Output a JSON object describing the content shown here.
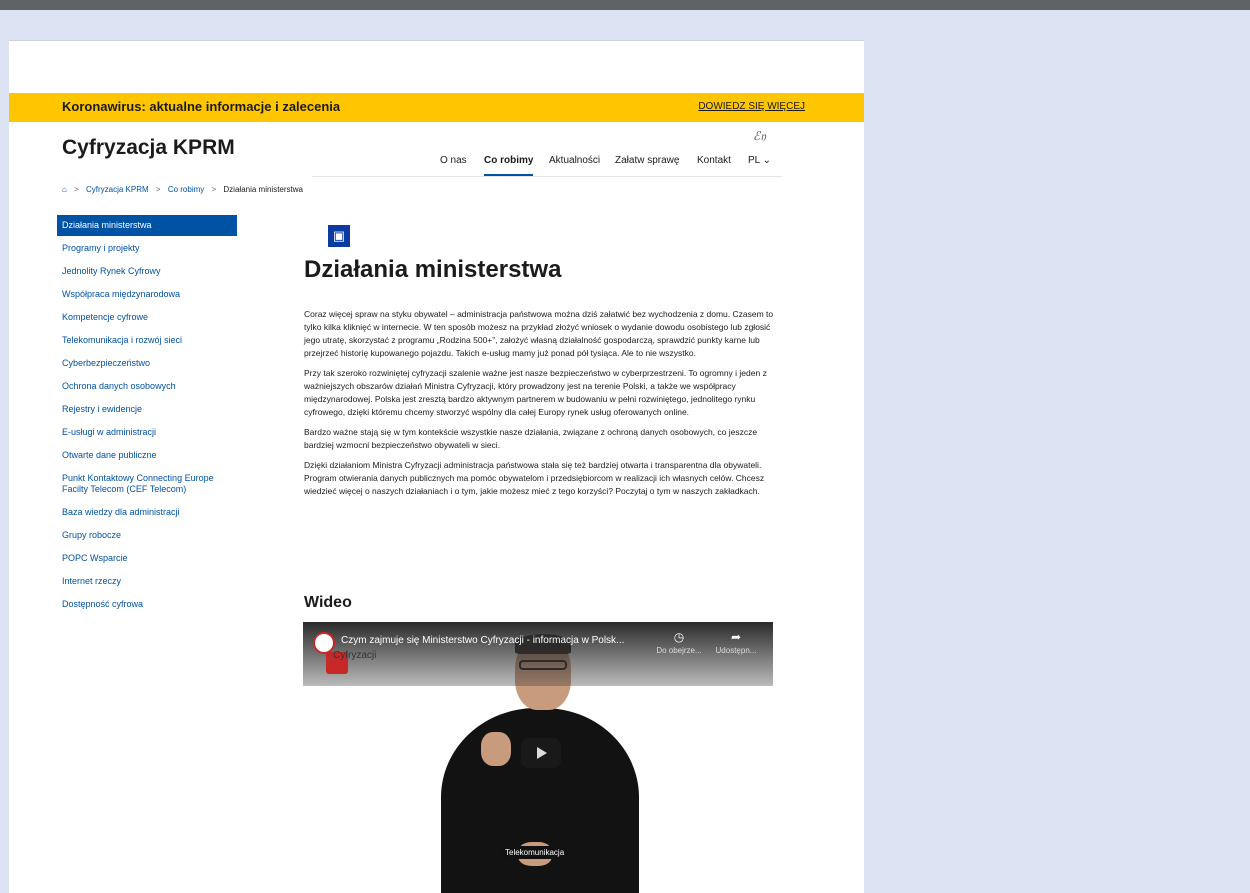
{
  "covid": {
    "title": "Koronawirus: aktualne informacje i zalecenia",
    "link": "DOWIEDZ SIĘ WIĘCEJ"
  },
  "header": {
    "brand": "Cyfryzacja KPRM",
    "nav": [
      "O nas",
      "Co robimy",
      "Aktualności",
      "Załatw sprawę",
      "Kontakt",
      "PL"
    ],
    "active_nav": "Co robimy",
    "lang_glyph": "ℰ𝔶"
  },
  "breadcrumb": {
    "home_icon": "⌂",
    "items": [
      "Cyfryzacja KPRM",
      "Co robimy",
      "Działania ministerstwa"
    ]
  },
  "sidebar": {
    "items": [
      "Działania ministerstwa",
      "Programy i projekty",
      "Jednolity Rynek Cyfrowy",
      "Współpraca międzynarodowa",
      "Kompetencje cyfrowe",
      "Telekomunikacja i rozwój sieci",
      "Cyberbezpieczeństwo",
      "Ochrona danych osobowych",
      "Rejestry i ewidencje",
      "E-usługi w administracji",
      "Otwarte dane publiczne",
      "Punkt Kontaktowy Connecting Europe Facilty Telecom (CEF Telecom)",
      "Baza wiedzy dla administracji",
      "Grupy robocze",
      "POPC Wsparcie",
      "Internet rzeczy",
      "Dostępność cyfrowa"
    ]
  },
  "main": {
    "icon": "▣",
    "title": "Działania ministerstwa",
    "paragraphs": [
      "Coraz więcej spraw na styku obywatel – administracja państwowa można dziś załatwić bez wychodzenia z domu. Czasem to tylko kilka kliknięć w internecie. W ten sposób możesz na przykład złożyć wniosek o wydanie dowodu osobistego lub zgłosić jego utratę, skorzystać z programu „Rodzina 500+”, założyć własną działalność gospodarczą, sprawdzić punkty karne lub przejrzeć historię kupowanego pojazdu. Takich e-usług mamy już ponad pół tysiąca. Ale to nie wszystko.",
      "Przy tak szeroko rozwiniętej cyfryzacji szalenie ważne jest nasze bezpieczeństwo w cyberprzestrzeni. To ogromny i jeden z ważniejszych obszarów działań Ministra Cyfryzacji, który prowadzony jest na terenie Polski, a także we współpracy międzynarodowej. Polska jest zresztą bardzo aktywnym partnerem w budowaniu w pełni rozwiniętego, jednolitego rynku cyfrowego, dzięki któremu chcemy stworzyć wspólny dla całej Europy rynek usług oferowanych online.",
      "Bardzo ważne stają się w tym kontekście wszystkie nasze działania, związane z ochroną danych osobowych, co jeszcze bardziej wzmocni bezpieczeństwo obywateli w sieci.",
      "Dzięki działaniom Ministra Cyfryzacji administracja państwowa stała się też bardziej otwarta i transparentna dla obywateli. Program otwierania danych publicznych ma pomóc obywatelom i przedsiębiorcom w realizacji ich własnych celów. Chcesz wiedzieć więcej o naszych działaniach i o tym, jakie możesz mieć z tego korzyści? Poczytaj o tym w naszych zakładkach."
    ],
    "video_heading": "Wideo"
  },
  "video": {
    "title": "Czym zajmuje się Ministerstwo Cyfryzacji - informacja w Polsk...",
    "channel": "Cyfryzacji",
    "watch_later": "Do obejrze...",
    "share": "Udostępn...",
    "caption": "Telekomunikacja"
  }
}
